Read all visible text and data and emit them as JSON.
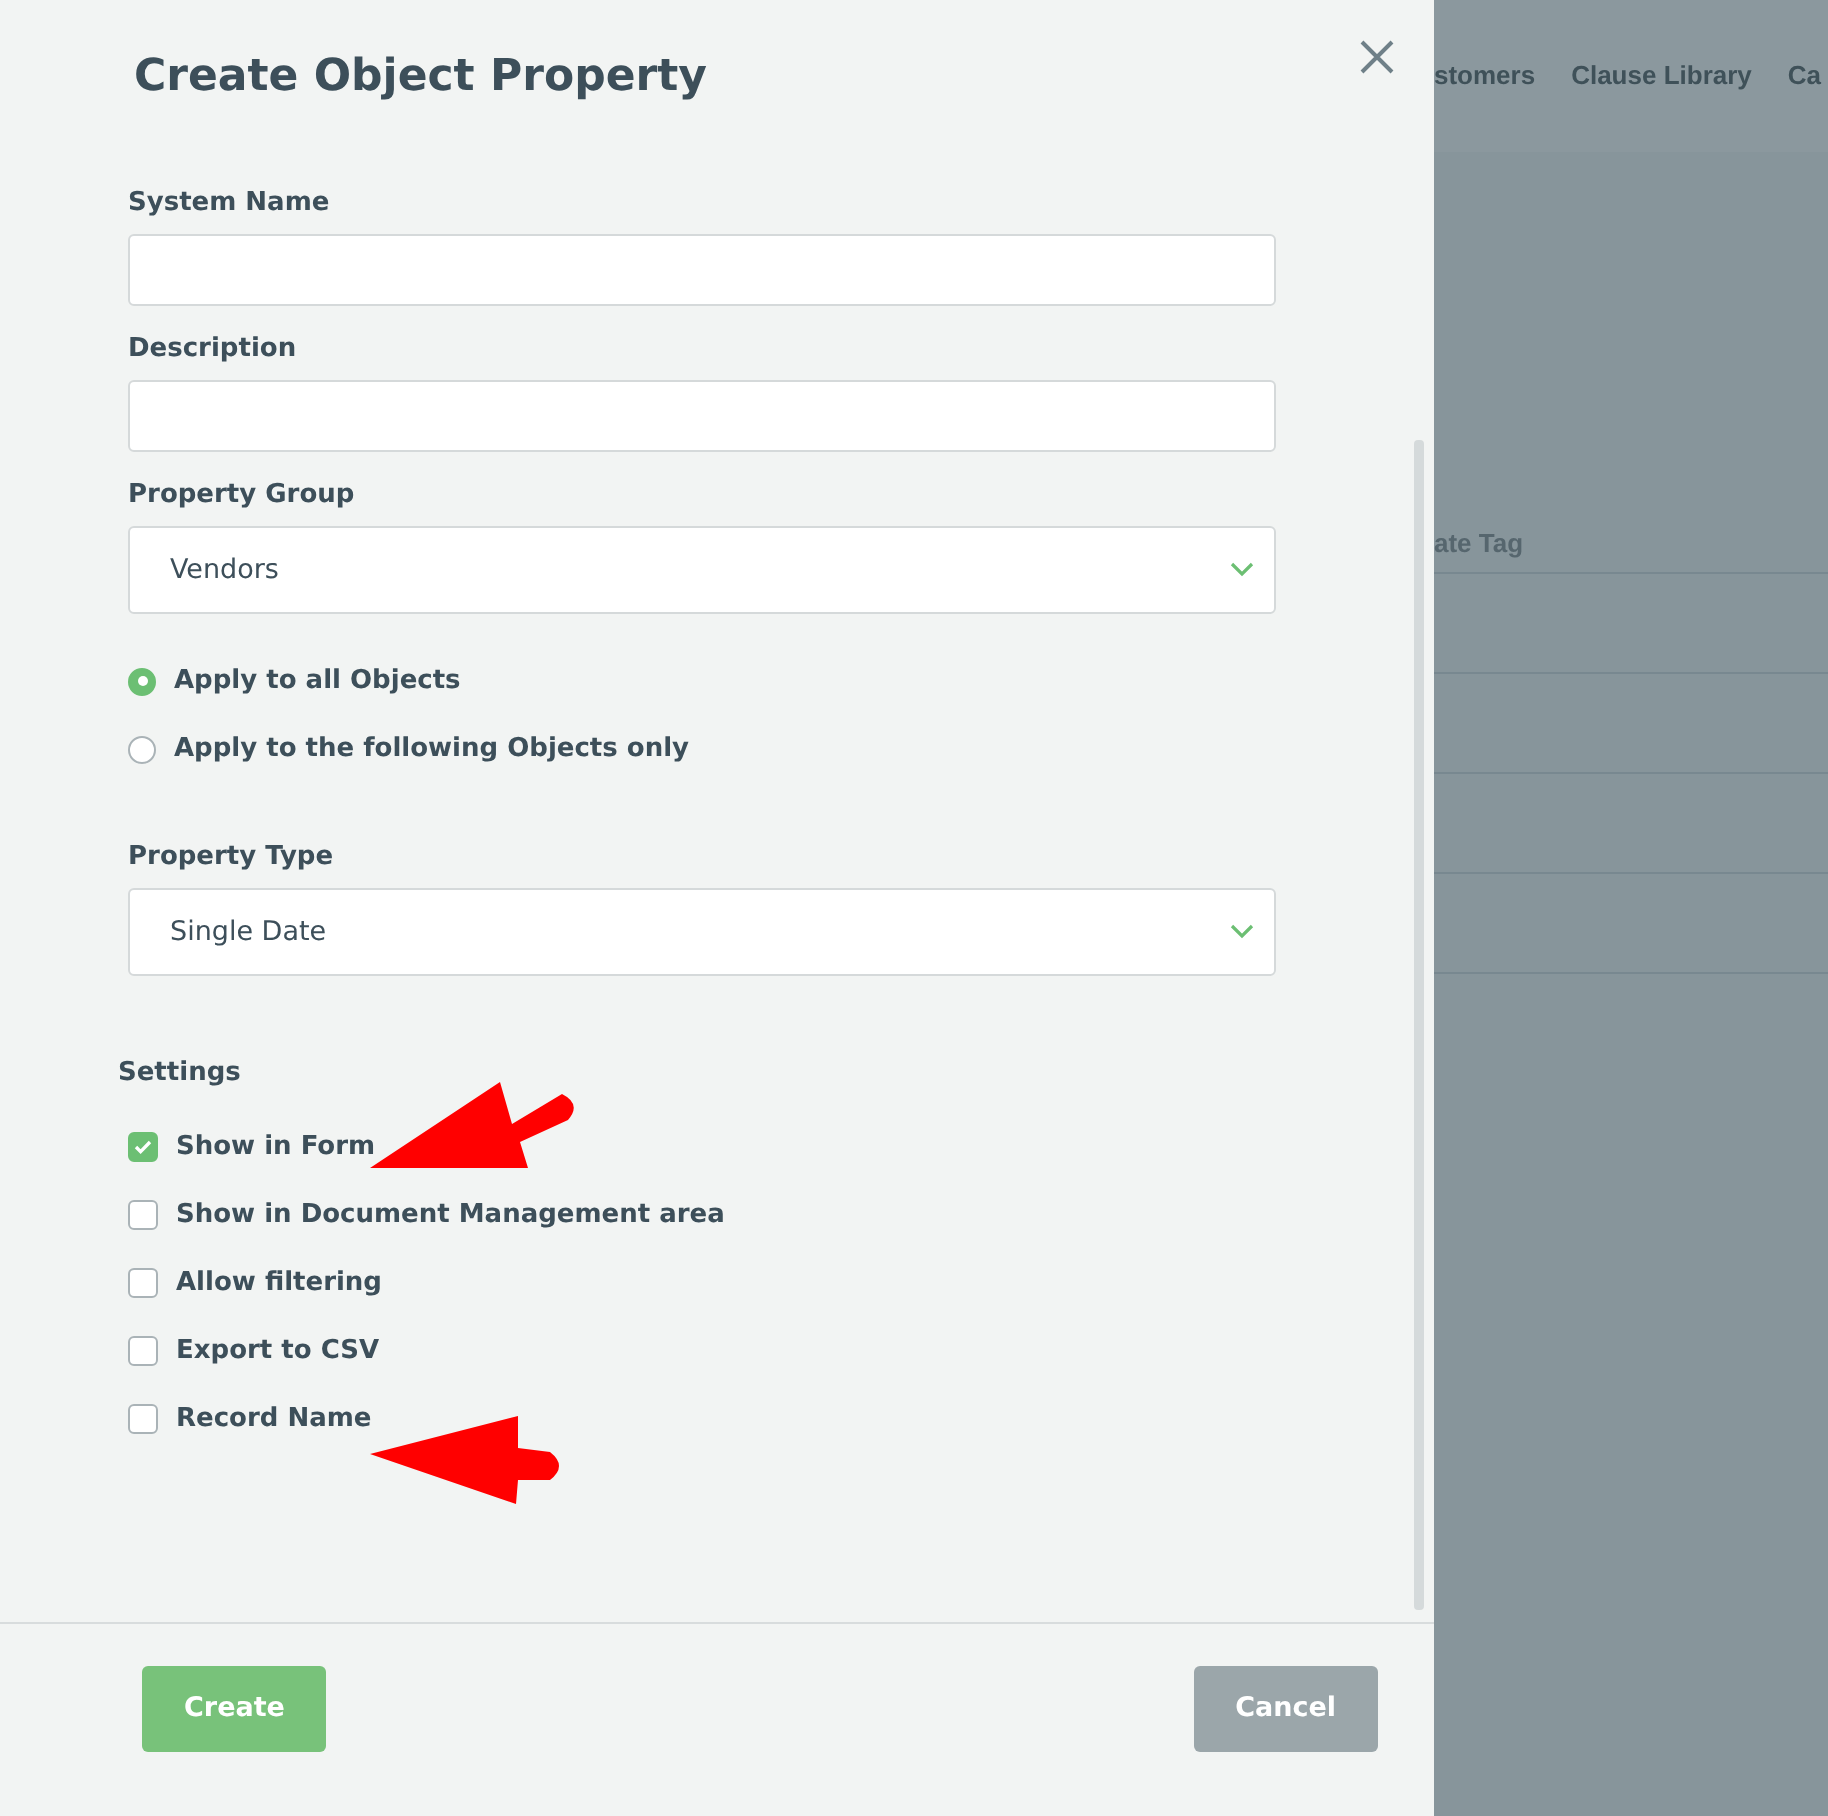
{
  "background": {
    "nav_items": [
      "stomers",
      "Clause Library",
      "Ca"
    ],
    "table": {
      "column_1": "ate Tag"
    }
  },
  "dialog": {
    "title": "Create Object Property",
    "fields": [
      {
        "label": "System Name",
        "kind": "text"
      },
      {
        "label": "Description",
        "kind": "text"
      },
      {
        "label": "Property Group",
        "kind": "select",
        "value": "Vendors"
      }
    ],
    "scope": [
      {
        "label": "Apply to all Objects",
        "selected": true
      },
      {
        "label": "Apply to the following Objects only",
        "selected": false
      }
    ],
    "property_type": {
      "label": "Property Type",
      "kind": "select",
      "value": "Single Date"
    },
    "settings": {
      "label": "Settings",
      "options": [
        {
          "label": "Show in Form",
          "checked": true
        },
        {
          "label": "Show in Document Management area",
          "checked": false
        },
        {
          "label": "Allow filtering",
          "checked": false
        },
        {
          "label": "Export to CSV",
          "checked": false
        },
        {
          "label": "Record Name",
          "checked": false
        }
      ]
    },
    "buttons": [
      {
        "label": "Create",
        "kind": "primary"
      },
      {
        "label": "Cancel",
        "kind": "secondary"
      }
    ]
  }
}
